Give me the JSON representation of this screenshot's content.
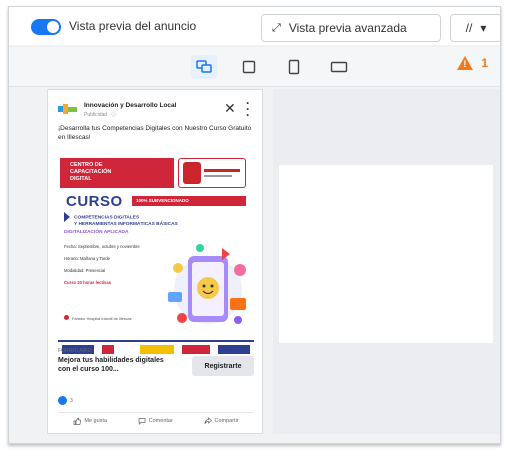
{
  "toolbar": {
    "toggle_label": "Vista previa del anuncio",
    "advanced_preview_label": "Vista previa avanzada",
    "advanced_preview_icon": "expand-arrows-icon",
    "more_label": "//"
  },
  "placements": [
    {
      "name": "feed-placement",
      "active": true
    },
    {
      "name": "square-placement",
      "active": false
    },
    {
      "name": "vertical-placement",
      "active": false
    },
    {
      "name": "horizontal-placement",
      "active": false
    }
  ],
  "warnings": {
    "count": "1"
  },
  "ad": {
    "page_name": "Innovación y Desarrollo Local",
    "sponsored": "Publicidad · ⓘ",
    "primary_text": "¡Desarrolla tus Competencias Digitales con Nuestro Curso Gratuito en Illescas!",
    "creative": {
      "banner_line1": "CENTRO DE",
      "banner_line2": "CAPACITACIÓN",
      "banner_line3": "DIGITAL",
      "curso": "CURSO",
      "curso_tag": "100% SUBVENCIONADO",
      "subtitle_line1": "COMPETENCIAS DIGITALES",
      "subtitle_line2": "Y HERRAMIENTAS INFORMÁTICAS BÁSICAS",
      "digitalizacion": "DIGITALIZACIÓN APLICADA",
      "detail1": "Fecha: Septiembre, octubre y noviembre",
      "detail2": "Horario: Mañana y Tarde",
      "detail3": "Modalidad: Presencial",
      "detail4": "Curso 30 horas lectivas",
      "address": "Parador Hospital Infantil de Illescas"
    },
    "cta_caption": "FORMULARIO",
    "cta_title": "Mejora tus habilidades digitales con el curso 100...",
    "cta_button": "Registrarte",
    "reaction_count": "3",
    "actions": {
      "like": "Me gusta",
      "comment": "Comentar",
      "share": "Compartir"
    }
  },
  "colors": {
    "accent": "#1877f2",
    "brand_red": "#d0263a",
    "brand_blue": "#2d3f8f",
    "warning": "#f07a1c"
  }
}
